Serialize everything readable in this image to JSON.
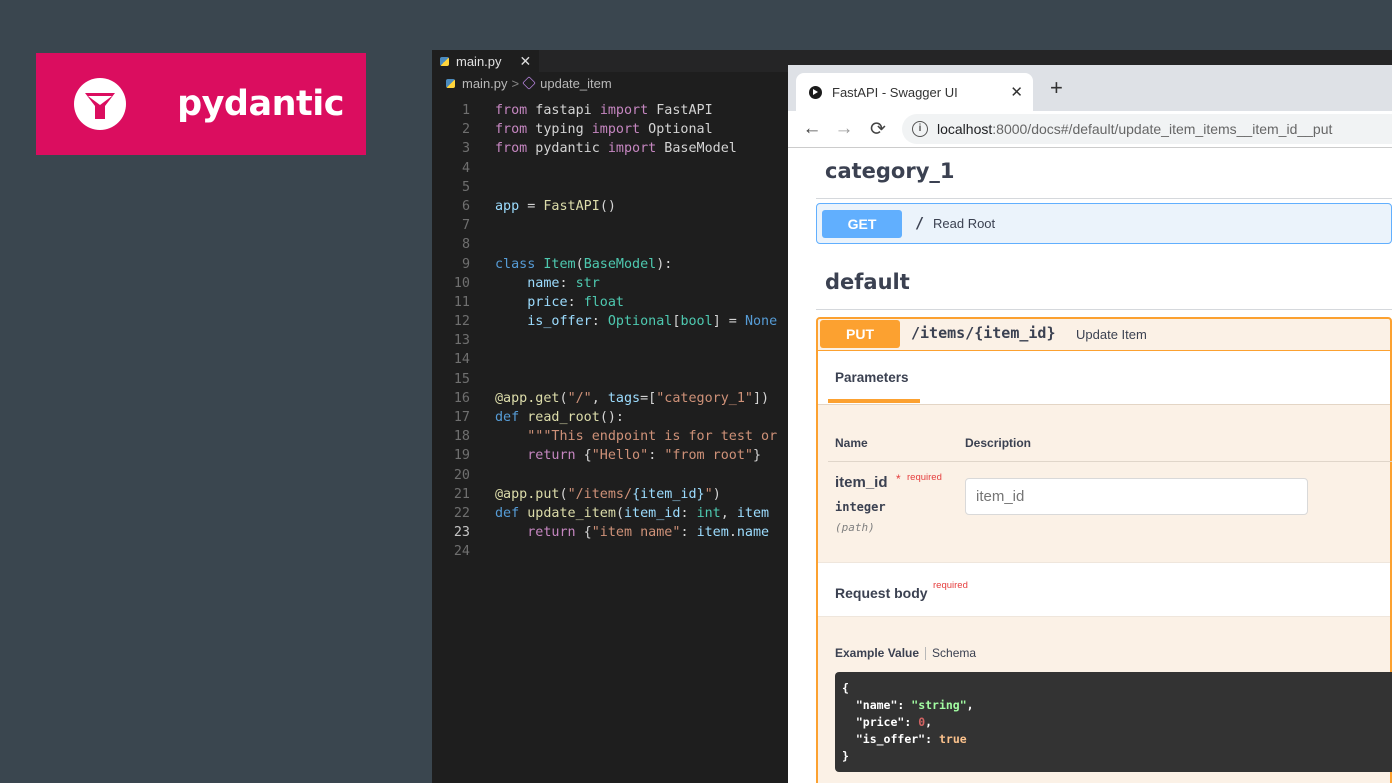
{
  "logo": {
    "text": "pydantic"
  },
  "editor": {
    "tab_label": "main.py",
    "tab_close": "✕",
    "breadcrumb_file": "main.py",
    "breadcrumb_separator": ">",
    "breadcrumb_symbol": "update_item",
    "current_line": 23,
    "lines": [
      [
        [
          "kw",
          "from"
        ],
        [
          "p",
          " fastapi "
        ],
        [
          "kw",
          "import"
        ],
        [
          "p",
          " FastAPI"
        ]
      ],
      [
        [
          "kw",
          "from"
        ],
        [
          "p",
          " typing "
        ],
        [
          "kw",
          "import"
        ],
        [
          "p",
          " Optional"
        ]
      ],
      [
        [
          "kw",
          "from"
        ],
        [
          "p",
          " pydantic "
        ],
        [
          "kw",
          "import"
        ],
        [
          "p",
          " BaseModel"
        ]
      ],
      [],
      [],
      [
        [
          "v",
          "app"
        ],
        [
          "p",
          " = "
        ],
        [
          "fn",
          "FastAPI"
        ],
        [
          "p",
          "()"
        ]
      ],
      [],
      [],
      [
        [
          "st",
          "class"
        ],
        [
          "p",
          " "
        ],
        [
          "cls",
          "Item"
        ],
        [
          "p",
          "("
        ],
        [
          "cls",
          "BaseModel"
        ],
        [
          "p",
          "):"
        ]
      ],
      [
        [
          "p",
          "    "
        ],
        [
          "v",
          "name"
        ],
        [
          "p",
          ": "
        ],
        [
          "cls",
          "str"
        ]
      ],
      [
        [
          "p",
          "    "
        ],
        [
          "v",
          "price"
        ],
        [
          "p",
          ": "
        ],
        [
          "cls",
          "float"
        ]
      ],
      [
        [
          "p",
          "    "
        ],
        [
          "v",
          "is_offer"
        ],
        [
          "p",
          ": "
        ],
        [
          "cls",
          "Optional"
        ],
        [
          "p",
          "["
        ],
        [
          "cls",
          "bool"
        ],
        [
          "p",
          "] = "
        ],
        [
          "const",
          "None"
        ]
      ],
      [],
      [],
      [],
      [
        [
          "fn",
          "@app.get"
        ],
        [
          "p",
          "("
        ],
        [
          "str",
          "\"/\""
        ],
        [
          "p",
          ", "
        ],
        [
          "v",
          "tags"
        ],
        [
          "p",
          "=["
        ],
        [
          "str",
          "\"category_1\""
        ],
        [
          "p",
          "])"
        ]
      ],
      [
        [
          "st",
          "def"
        ],
        [
          "p",
          " "
        ],
        [
          "fn",
          "read_root"
        ],
        [
          "p",
          "():"
        ]
      ],
      [
        [
          "p",
          "    "
        ],
        [
          "str",
          "\"\"\"This endpoint is for test or"
        ]
      ],
      [
        [
          "p",
          "    "
        ],
        [
          "kw",
          "return"
        ],
        [
          "p",
          " {"
        ],
        [
          "str",
          "\"Hello\""
        ],
        [
          "p",
          ": "
        ],
        [
          "str",
          "\"from root\""
        ],
        [
          "p",
          "}"
        ]
      ],
      [],
      [
        [
          "fn",
          "@app.put"
        ],
        [
          "p",
          "("
        ],
        [
          "str",
          "\"/items/"
        ],
        [
          "ph",
          "{item_id}"
        ],
        [
          "str",
          "\""
        ],
        [
          "p",
          ")"
        ]
      ],
      [
        [
          "st",
          "def"
        ],
        [
          "p",
          " "
        ],
        [
          "fn",
          "update_item"
        ],
        [
          "p",
          "("
        ],
        [
          "v",
          "item_id"
        ],
        [
          "p",
          ": "
        ],
        [
          "cls",
          "int"
        ],
        [
          "p",
          ", "
        ],
        [
          "v",
          "item"
        ]
      ],
      [
        [
          "p",
          "    "
        ],
        [
          "kw",
          "return"
        ],
        [
          "p",
          " {"
        ],
        [
          "str",
          "\"item name\""
        ],
        [
          "p",
          ": "
        ],
        [
          "v",
          "item"
        ],
        [
          "p",
          "."
        ],
        [
          "v",
          "name"
        ]
      ],
      []
    ]
  },
  "browser": {
    "tab_title": "FastAPI - Swagger UI",
    "tab_close": "✕",
    "new_tab": "+",
    "back": "←",
    "forward": "→",
    "reload": "⟳",
    "info": "i",
    "url_host": "localhost",
    "url_rest": ":8000/docs#/default/update_item_items__item_id__put"
  },
  "swagger": {
    "section1": "category_1",
    "get_method": "GET",
    "get_path": "/",
    "get_summary": "Read Root",
    "section2": "default",
    "put_method": "PUT",
    "put_path": "/items/{item_id}",
    "put_summary": "Update Item",
    "parameters_tab": "Parameters",
    "col_name": "Name",
    "col_description": "Description",
    "param_name": "item_id",
    "required_star": "*",
    "required_label": "required",
    "param_type": "integer",
    "param_in": "(path)",
    "param_placeholder": "item_id",
    "request_body": "Request body",
    "request_body_required": "required",
    "example_value_tab": "Example Value",
    "schema_tab": "Schema",
    "example_lines": [
      [
        [
          "b",
          "{"
        ]
      ],
      [
        [
          "b",
          "  "
        ],
        [
          "k",
          "\"name\""
        ],
        [
          "b",
          ": "
        ],
        [
          "s",
          "\"string\""
        ],
        [
          "b",
          ","
        ]
      ],
      [
        [
          "b",
          "  "
        ],
        [
          "k",
          "\"price\""
        ],
        [
          "b",
          ": "
        ],
        [
          "n",
          "0"
        ],
        [
          "b",
          ","
        ]
      ],
      [
        [
          "b",
          "  "
        ],
        [
          "k",
          "\"is_offer\""
        ],
        [
          "b",
          ": "
        ],
        [
          "t",
          "true"
        ]
      ],
      [
        [
          "b",
          "}"
        ]
      ]
    ]
  },
  "colors": {
    "pydantic_brand": "#db0d5f",
    "get_blue": "#61affe",
    "put_orange": "#fca130",
    "editor_bg": "#1e1e1e"
  }
}
